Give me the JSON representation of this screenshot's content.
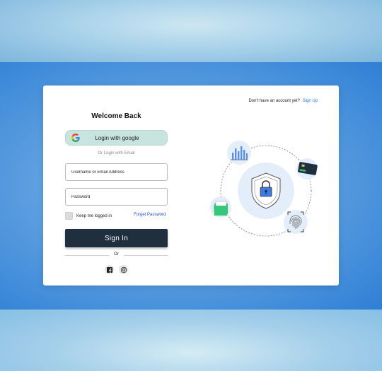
{
  "header": {
    "signup_prompt": "Don't have an account yet?",
    "signup_link": "Sign Up"
  },
  "form": {
    "title": "Welcome Back",
    "google_button": "Login with google",
    "or_email": "Or Login with Email",
    "username_placeholder": "Username or Email Address",
    "password_placeholder": "Password",
    "remember_label": "Keep me logged in",
    "forgot_link": "Forget Password",
    "signin_button": "Sign In",
    "or_divider": "Or"
  },
  "social": [
    "facebook-icon",
    "instagram-icon"
  ],
  "illustration": {
    "icons": [
      "shield-lock-icon",
      "bar-chart-icon",
      "credit-card-icon",
      "folder-icon",
      "fingerprint-icon"
    ]
  },
  "colors": {
    "accent": "#1a73e8",
    "signin_bg": "#1f2f3d",
    "google_bg": "#c8e4df"
  }
}
